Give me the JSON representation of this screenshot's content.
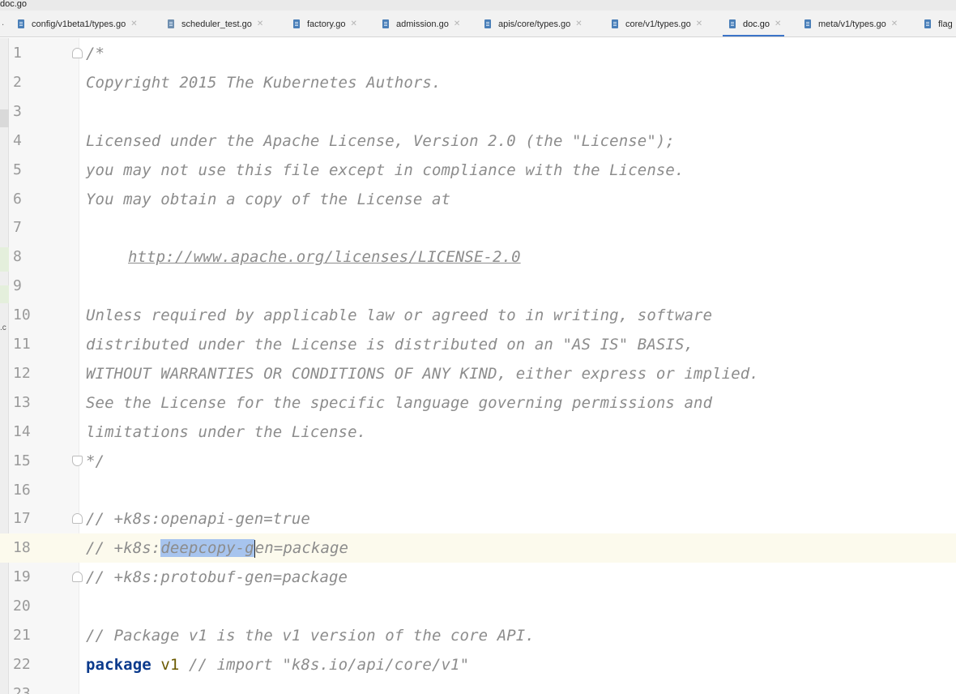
{
  "window": {
    "title": "doc.go"
  },
  "tabs": [
    {
      "label": "config/v1beta1/types.go",
      "test": false,
      "active": false
    },
    {
      "label": "scheduler_test.go",
      "test": true,
      "active": false
    },
    {
      "label": "factory.go",
      "test": false,
      "active": false
    },
    {
      "label": "admission.go",
      "test": false,
      "active": false
    },
    {
      "label": "apis/core/types.go",
      "test": false,
      "active": false
    },
    {
      "label": "core/v1/types.go",
      "test": false,
      "active": false
    },
    {
      "label": "doc.go",
      "test": false,
      "active": true
    },
    {
      "label": "meta/v1/types.go",
      "test": false,
      "active": false
    },
    {
      "label": "flag",
      "test": false,
      "active": false
    }
  ],
  "editor": {
    "side_fragment": ".c",
    "current_line": 18,
    "lines": [
      {
        "n": "1",
        "text": "/*"
      },
      {
        "n": "2",
        "text": "Copyright 2015 The Kubernetes Authors."
      },
      {
        "n": "3",
        "text": ""
      },
      {
        "n": "4",
        "text": "Licensed under the Apache License, Version 2.0 (the \"License\");"
      },
      {
        "n": "5",
        "text": "you may not use this file except in compliance with the License."
      },
      {
        "n": "6",
        "text": "You may obtain a copy of the License at"
      },
      {
        "n": "7",
        "text": ""
      },
      {
        "n": "8",
        "text": "http://www.apache.org/licenses/LICENSE-2.0"
      },
      {
        "n": "9",
        "text": ""
      },
      {
        "n": "10",
        "text": "Unless required by applicable law or agreed to in writing, software"
      },
      {
        "n": "11",
        "text": "distributed under the License is distributed on an \"AS IS\" BASIS,"
      },
      {
        "n": "12",
        "text": "WITHOUT WARRANTIES OR CONDITIONS OF ANY KIND, either express or implied."
      },
      {
        "n": "13",
        "text": "See the License for the specific language governing permissions and"
      },
      {
        "n": "14",
        "text": "limitations under the License."
      },
      {
        "n": "15",
        "text": "*/"
      },
      {
        "n": "16",
        "text": ""
      },
      {
        "n": "17",
        "text": "// +k8s:openapi-gen=true"
      },
      {
        "n": "18",
        "pre": "// +k8s:",
        "selected": "deepcopy-g",
        "post": "en=package"
      },
      {
        "n": "19",
        "text": "// +k8s:protobuf-gen=package"
      },
      {
        "n": "20",
        "text": ""
      },
      {
        "n": "21",
        "text": "// Package v1 is the v1 version of the core API."
      },
      {
        "n": "22",
        "keyword": "package",
        "ident": "v1",
        "comment": "// import \"k8s.io/api/core/v1\""
      },
      {
        "n": "23",
        "text": ""
      }
    ]
  },
  "colors": {
    "accent": "#3b74c8",
    "selection": "#a7c4ee",
    "comment": "#8c8c8c",
    "keyword": "#0b3a8c",
    "current_line": "#fcfaed"
  }
}
